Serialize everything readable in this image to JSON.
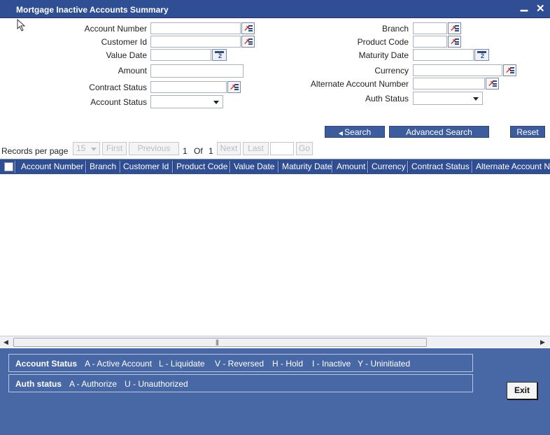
{
  "window": {
    "title": "Mortgage Inactive Accounts Summary",
    "minimize": "▁",
    "close": "✕"
  },
  "form": {
    "account_number": {
      "label": "Account Number",
      "value": ""
    },
    "customer_id": {
      "label": "Customer Id",
      "value": ""
    },
    "value_date": {
      "label": "Value Date",
      "value": ""
    },
    "amount": {
      "label": "Amount",
      "value": ""
    },
    "contract_status": {
      "label": "Contract Status",
      "value": ""
    },
    "account_status": {
      "label": "Account Status",
      "value": ""
    },
    "branch": {
      "label": "Branch",
      "value": ""
    },
    "product_code": {
      "label": "Product Code",
      "value": ""
    },
    "maturity_date": {
      "label": "Maturity Date",
      "value": ""
    },
    "currency": {
      "label": "Currency",
      "value": ""
    },
    "alternate_account_number": {
      "label": "Alternate Account Number",
      "value": ""
    },
    "auth_status": {
      "label": "Auth Status",
      "value": ""
    }
  },
  "buttons": {
    "search": "Search",
    "advanced_search": "Advanced Search",
    "reset": "Reset",
    "exit": "Exit"
  },
  "pager": {
    "records_label": "Records per page",
    "per_page": "15",
    "first": "First",
    "previous": "Previous",
    "current_page": "1",
    "of": "Of",
    "total_pages": "1",
    "next": "Next",
    "last": "Last",
    "go": "Go"
  },
  "grid": {
    "columns": [
      "Account Number",
      "Branch",
      "Customer Id",
      "Product Code",
      "Value Date",
      "Maturity Date",
      "Amount",
      "Currency",
      "Contract Status",
      "Alternate Account N"
    ]
  },
  "legend": {
    "account_status": {
      "title": "Account Status",
      "items": [
        "A - Active Account",
        "L - Liquidate",
        "V - Reversed",
        "H - Hold",
        "I - Inactive",
        "Y - Uninitiated"
      ]
    },
    "auth_status": {
      "title": "Auth status",
      "items": [
        "A - Authorize",
        "U - Unauthorized"
      ]
    }
  },
  "icons": [
    "lov-icon",
    "calendar-icon",
    "dropdown-arrow-icon",
    "scroll-left-icon",
    "scroll-right-icon"
  ],
  "colors": {
    "title_bar": "#2f4e93",
    "grid_header": "#2f4e93",
    "button": "#3d5c9e",
    "footer": "#4867a5",
    "lov_arrow": "#d2331c"
  }
}
